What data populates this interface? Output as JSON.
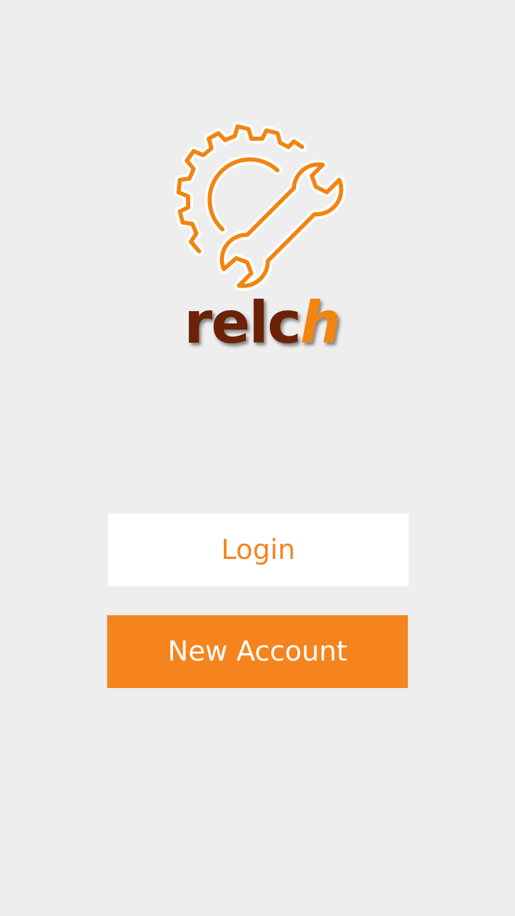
{
  "brand": {
    "logo_icon": "gear-wrench-icon",
    "wordmark_dark": "relc",
    "wordmark_accent": "h",
    "color_dark": "#6b2208",
    "color_accent": "#f28410"
  },
  "actions": {
    "login_label": "Login",
    "new_account_label": "New Account"
  },
  "colors": {
    "background": "#eeeeee",
    "primary": "#f5841f",
    "login_bg": "#ffffff"
  }
}
